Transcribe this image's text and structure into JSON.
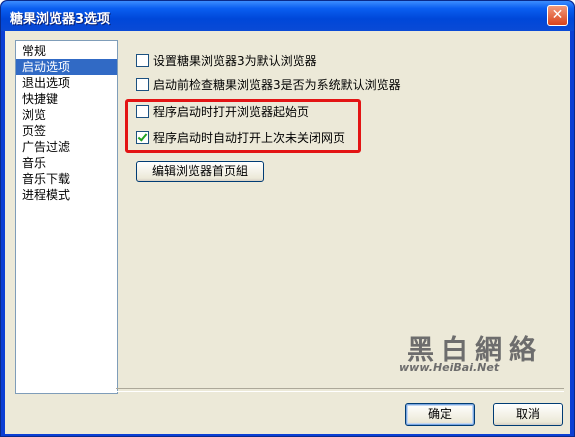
{
  "window": {
    "title": "糖果浏览器3选项"
  },
  "nav": {
    "items": [
      {
        "label": "常规",
        "selected": false
      },
      {
        "label": "启动选项",
        "selected": true
      },
      {
        "label": "退出选项",
        "selected": false
      },
      {
        "label": "快捷键",
        "selected": false
      },
      {
        "label": "浏览",
        "selected": false
      },
      {
        "label": "页签",
        "selected": false
      },
      {
        "label": "广告过滤",
        "selected": false
      },
      {
        "label": "音乐",
        "selected": false
      },
      {
        "label": "音乐下载",
        "selected": false
      },
      {
        "label": "进程模式",
        "selected": false
      }
    ]
  },
  "options": {
    "set_default": {
      "label": "设置糖果浏览器3为默认浏览器",
      "checked": false
    },
    "check_default": {
      "label": "启动前检查糖果浏览器3是否为系统默认浏览器",
      "checked": false
    },
    "open_homepage": {
      "label": "程序启动时打开浏览器起始页",
      "checked": false
    },
    "restore_pages": {
      "label": "程序启动时自动打开上次未关闭网页",
      "checked": true
    }
  },
  "buttons": {
    "edit_homepage_group": "编辑浏览器首页組",
    "ok": "确定",
    "cancel": "取消"
  },
  "watermark": {
    "chars": "黑白網絡",
    "url": "www.HeiBai.Net"
  },
  "colors": {
    "selection": "#316ac5",
    "highlight_box": "#e31414",
    "titlebar": "#0a5ef0",
    "dialog_bg": "#ece9d8"
  }
}
